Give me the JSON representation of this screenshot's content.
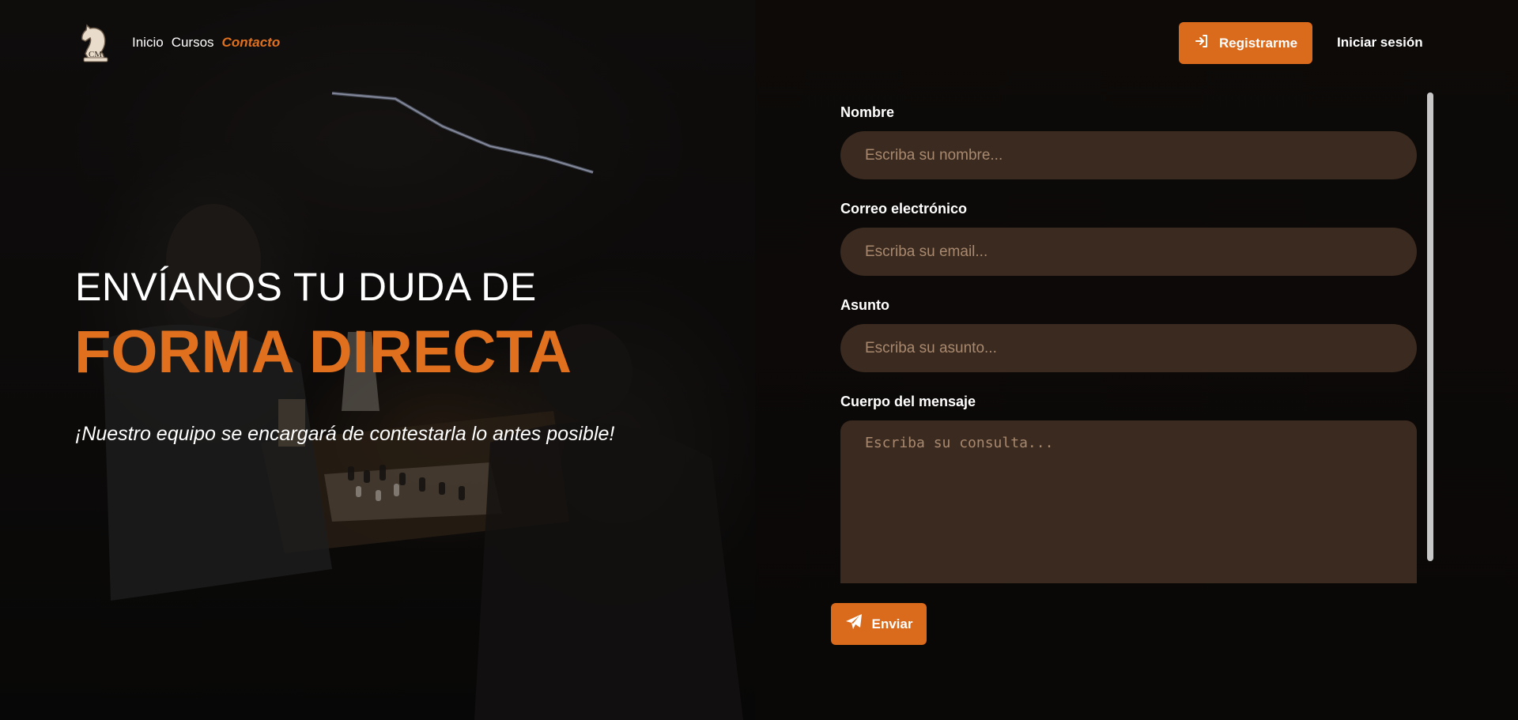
{
  "brand": {
    "logo_icon": "chess-knight-logo-icon",
    "logo_letters": "CM"
  },
  "nav": {
    "items": [
      {
        "label": "Inicio"
      },
      {
        "label": "Cursos"
      },
      {
        "label": "Contacto",
        "active": true
      }
    ]
  },
  "header": {
    "register_label": "Registrarme",
    "register_icon": "login-arrow-icon",
    "login_label": "Iniciar sesión"
  },
  "hero": {
    "title_line_1": "ENVÍANOS TU DUDA DE",
    "title_line_2": "FORMA DIRECTA",
    "subtitle": "¡Nuestro equipo se encargará de contestarla lo antes posible!"
  },
  "form": {
    "name_label": "Nombre",
    "name_placeholder": "Escriba su nombre...",
    "email_label": "Correo electrónico",
    "email_placeholder": "Escriba su email...",
    "subject_label": "Asunto",
    "subject_placeholder": "Escriba su asunto...",
    "body_label": "Cuerpo del mensaje",
    "body_placeholder": "Escriba su consulta...",
    "send_label": "Enviar",
    "send_icon": "paper-plane-icon"
  },
  "colors": {
    "accent": "#da6a1c",
    "accent_text": "#e0701e",
    "input_bg": "#3b2a1f",
    "placeholder": "#a8896f"
  }
}
